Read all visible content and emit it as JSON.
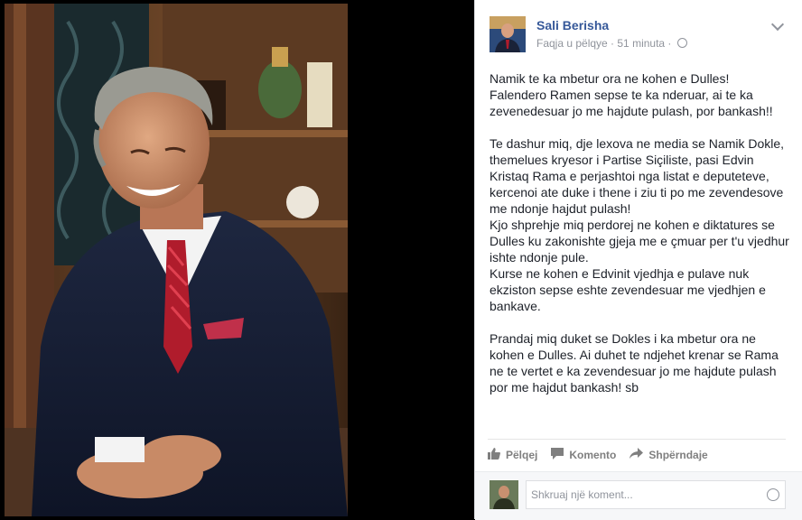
{
  "post": {
    "author": "Sali Berisha",
    "meta_prefix": "Faqja u pëlqye · 51 minuta ·",
    "paragraphs": [
      "Namik te ka mbetur ora ne kohen e Dulles!\nFalendero Ramen sepse te ka nderuar, ai te ka zevenedesuar jo me hajdute pulash, por bankash!!",
      "Te dashur miq, dje lexova ne media se Namik Dokle, themelues kryesor i Partise Siçiliste, pasi Edvin Kristaq Rama e perjashtoi nga listat e deputeteve, kercenoi ate duke i thene i ziu ti po me zevendesove me ndonje hajdut pulash!\nKjo shprehje miq perdorej ne kohen e diktatures se Dulles ku zakonishte gjeja me e çmuar per t'u vjedhur ishte ndonje pule.\nKurse ne kohen e Edvinit vjedhja e pulave nuk ekziston sepse eshte zevendesuar me vjedhjen e bankave.",
      "Prandaj miq duket se Dokles i ka mbetur ora ne kohen e Dulles. Ai duhet te ndjehet krenar se Rama ne te vertet e ka zevendesuar jo me hajdute pulash por me hajdut bankash! sb"
    ]
  },
  "actions": {
    "like": "Pëlqej",
    "comment": "Komento",
    "share": "Shpërndaje"
  },
  "comment": {
    "placeholder": "Shkruaj një koment..."
  },
  "colors": {
    "author_link": "#365899",
    "meta_gray": "#90949c",
    "action_gray": "#7f7f7f"
  }
}
